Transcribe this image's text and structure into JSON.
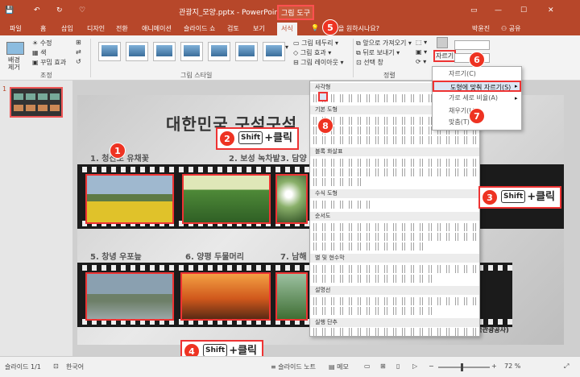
{
  "window": {
    "file_title": "관광지_모양.pptx - PowerPoint",
    "context_tab": "그림 도구",
    "user": "박윤진",
    "share": "공유",
    "quick_tool": "♡"
  },
  "tabs": [
    "파일",
    "홈",
    "삽입",
    "디자인",
    "전환",
    "애니메이션",
    "슬라이드 쇼",
    "검토",
    "보기",
    "서식"
  ],
  "tell_me": "을 원하시나요?",
  "ribbon": {
    "remove_bg": "배경\n제거",
    "adjust": [
      "수정",
      "색",
      "꾸밈 효과"
    ],
    "adjust_group": "조정",
    "styles_group": "그림 스타일",
    "border": "그림 테두리",
    "effect": "그림 효과",
    "layout": "그림 레이아웃",
    "bring_forward": "앞으로 가져오기",
    "send_back": "뒤로 보내기",
    "select_pane": "선택 창",
    "arrange_group": "정렬",
    "crop": "자르기"
  },
  "crop_menu": [
    "자르기(C)",
    "도형에 맞춰 자르기(S)",
    "가로 세로 비율(A)",
    "채우기(L)",
    "맞춤(T)"
  ],
  "shape_menu": {
    "sections": [
      "사각형",
      "기본 도형",
      "블록 화살표",
      "수식 도형",
      "순서도",
      "별 및 현수막",
      "설명선",
      "실행 단추"
    ]
  },
  "slide": {
    "title": "대한민국 구석구석",
    "labels": [
      "1. 청산도 유채꽃",
      "2. 보성 녹차밭",
      "3. 담양",
      "5. 창녕 우포늪",
      "6. 양평 두물머리",
      "7. 남해"
    ],
    "credit": "(사진출처 : 한국관광공사)"
  },
  "callouts": [
    {
      "num": "1"
    },
    {
      "num": "2",
      "key": "Shift",
      "text": "+클릭"
    },
    {
      "num": "3",
      "key": "Shift",
      "text": "+클릭"
    },
    {
      "num": "4",
      "key": "Shift",
      "text": "+클릭"
    },
    {
      "num": "5"
    },
    {
      "num": "6"
    },
    {
      "num": "7"
    },
    {
      "num": "8"
    }
  ],
  "thumb_number": "1",
  "statusbar": {
    "slide": "슬라이드 1/1",
    "lang": "한국어",
    "notes": "슬라이드 노트",
    "memo": "메모",
    "zoom": "72 %"
  },
  "colors": {
    "accent": "#b7472a",
    "highlight": "#e33333"
  }
}
